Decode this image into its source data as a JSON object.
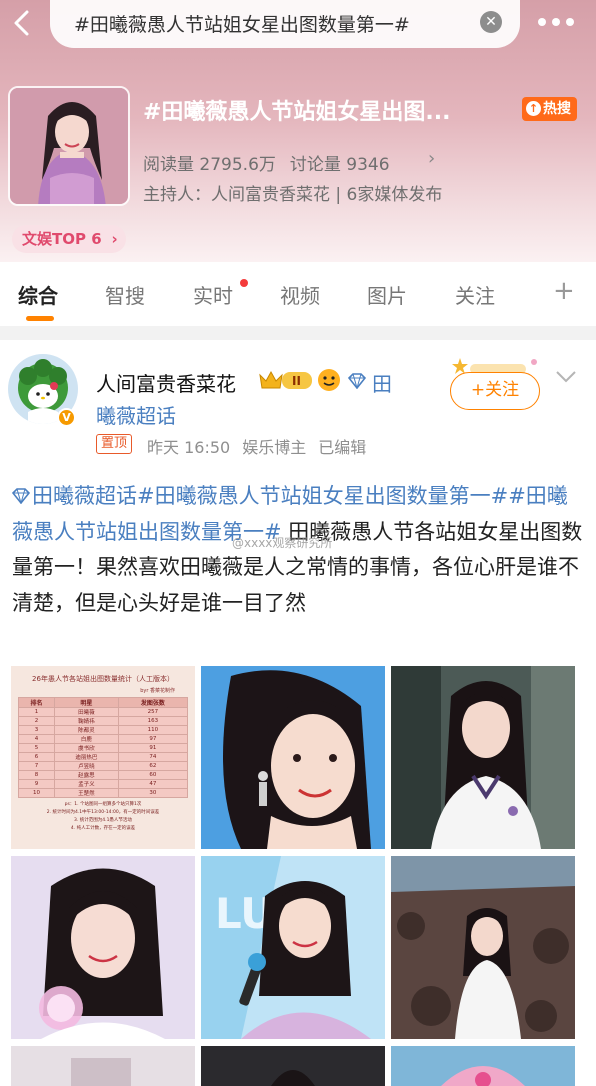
{
  "header": {
    "search_text": "#田曦薇愚人节站姐女星出图数量第一#",
    "topic_title": "#田曦薇愚人节站姐女星出图...",
    "hot_badge": "热搜",
    "read_count": "阅读量 2795.6万",
    "discuss_count": "讨论量 9346",
    "host": "主持人：人间富贵香菜花 | 6家媒体发布",
    "rank_badge": "文娱TOP 6",
    "colors": {
      "accent": "#ff8200",
      "hot": "#ff6a1a",
      "link": "#4a7fc0"
    }
  },
  "tabs": [
    {
      "label": "综合",
      "active": true
    },
    {
      "label": "智搜"
    },
    {
      "label": "实时",
      "dot": true
    },
    {
      "label": "视频"
    },
    {
      "label": "图片"
    },
    {
      "label": "关注"
    }
  ],
  "post": {
    "author": "人间富贵香菜花",
    "level_badge": "II",
    "super_link": "田曦薇超话",
    "follow_label": "+关注",
    "pin_label": "置顶",
    "time": "昨天 16:50",
    "source": "娱乐博主",
    "edited": "已编辑",
    "tag1": "田曦薇超话",
    "tag2": "#田曦薇愚人节站姐女星出图数量第一#",
    "tag3": "#田曦薇愚人节站姐出图数量第一#",
    "body": "田曦薇愚人节各站姐女星出图数量第一！果然喜欢田曦薇是人之常情的事情，各位心肝是谁不清楚，但是心头好是谁一目了然",
    "watermark": "@xxxx观察研究所"
  },
  "stats_image": {
    "title": "26年愚人节各站姐出图数量统计（人工版本）",
    "subtitle": "byr 香菜花制作",
    "headers": [
      "排名",
      "明星",
      "发图张数"
    ],
    "rows": [
      [
        "1",
        "田曦薇",
        "257"
      ],
      [
        "2",
        "鞠婧祎",
        "163"
      ],
      [
        "3",
        "陈都灵",
        "110"
      ],
      [
        "4",
        "白鹿",
        "97"
      ],
      [
        "5",
        "虞书欣",
        "91"
      ],
      [
        "6",
        "迪丽热巴",
        "74"
      ],
      [
        "7",
        "卢昱晓",
        "62"
      ],
      [
        "8",
        "赵露思",
        "60"
      ],
      [
        "9",
        "孟子义",
        "47"
      ],
      [
        "10",
        "王楚然",
        "30"
      ]
    ],
    "notes": [
      "ps：1. 个站图同一组算多个站只算1次",
      "2. 统计时间为4.1中午13:00-14:00，有一定的时间误差",
      "3. 统计范围为4.1愚人节活动",
      "4. 纯人工计数，存在一定的误差"
    ]
  }
}
